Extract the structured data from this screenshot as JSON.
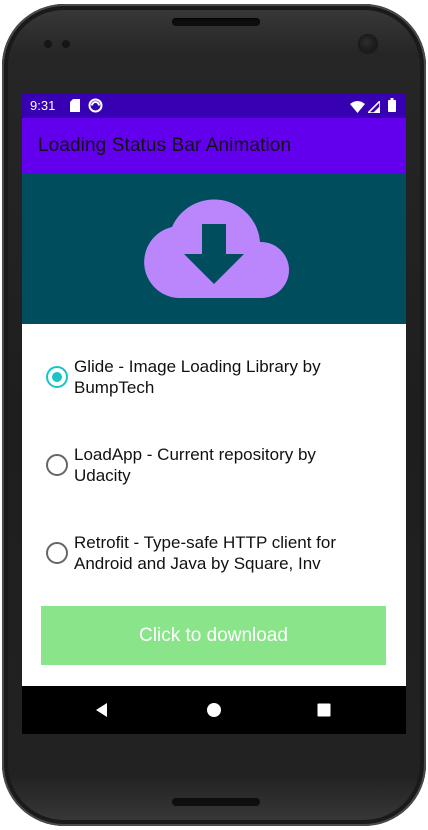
{
  "status_bar": {
    "time": "9:31",
    "background": "#3700b3",
    "left_icons": [
      "sd-card-icon",
      "sync-icon"
    ],
    "right_icons": [
      "wifi-icon",
      "signal-icon",
      "battery-icon"
    ]
  },
  "app_bar": {
    "title": "Loading Status Bar Animation",
    "background": "#6200ee"
  },
  "header": {
    "background": "#004d5e",
    "icon": "cloud-download-icon",
    "icon_color": "#bb86fc"
  },
  "options": [
    {
      "label": "Glide - Image Loading Library by BumpTech",
      "checked": true
    },
    {
      "label": "LoadApp - Current repository by Udacity",
      "checked": false
    },
    {
      "label": "Retrofit - Type-safe HTTP client for Android and Java by Square, Inv",
      "checked": false
    }
  ],
  "radio_accent": "#18c5c9",
  "download_button": {
    "label": "Click to download",
    "background": "#8ae58a"
  },
  "nav_bar": {
    "buttons": [
      "back-icon",
      "home-icon",
      "recents-icon"
    ]
  }
}
